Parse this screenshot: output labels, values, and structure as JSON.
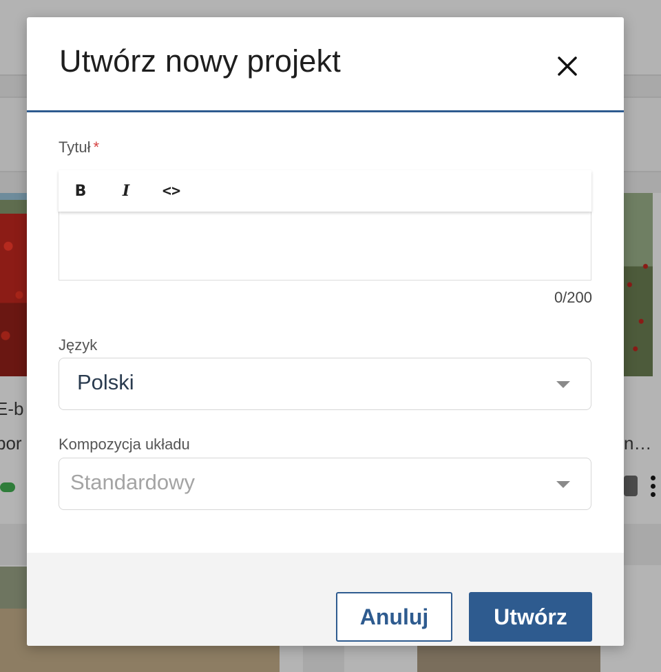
{
  "background": {
    "card_left_title_fragment": "E-b",
    "card_left_subtitle_fragment": "bor",
    "card_right_title_fragment": "n…"
  },
  "modal": {
    "title": "Utwórz nowy projekt",
    "close_icon": "close-icon",
    "title_field": {
      "label": "Tytuł",
      "required_marker": "*",
      "toolbar": {
        "bold": "B",
        "italic": "I",
        "code": "<>"
      },
      "value": "",
      "counter": "0/200"
    },
    "language_field": {
      "label": "Język",
      "selected": "Polski"
    },
    "layout_field": {
      "label": "Kompozycja układu",
      "selected": "Standardowy"
    },
    "footer": {
      "cancel_label": "Anuluj",
      "create_label": "Utwórz"
    }
  },
  "colors": {
    "accent": "#2e5b8f",
    "required": "#d64242",
    "overlay": "#a9a9a9"
  }
}
